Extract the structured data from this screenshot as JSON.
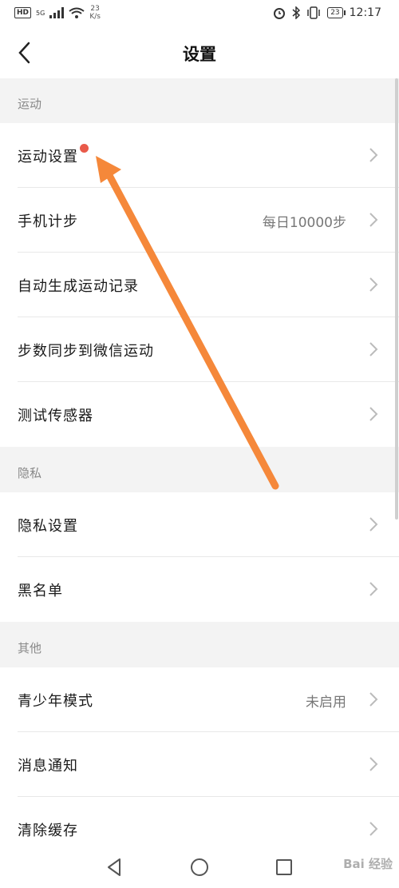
{
  "status_bar": {
    "network_badge": "HD",
    "signal_label": "5G",
    "net_speed_value": "23",
    "net_speed_unit": "K/s",
    "battery": "23",
    "time": "12:17"
  },
  "header": {
    "title": "设置"
  },
  "sections": [
    {
      "title": "运动",
      "items": [
        {
          "label": "运动设置",
          "value": "",
          "has_dot": true
        },
        {
          "label": "手机计步",
          "value": "每日10000步"
        },
        {
          "label": "自动生成运动记录",
          "value": ""
        },
        {
          "label": "步数同步到微信运动",
          "value": ""
        },
        {
          "label": "测试传感器",
          "value": ""
        }
      ]
    },
    {
      "title": "隐私",
      "items": [
        {
          "label": "隐私设置",
          "value": ""
        },
        {
          "label": "黑名单",
          "value": ""
        }
      ]
    },
    {
      "title": "其他",
      "items": [
        {
          "label": "青少年模式",
          "value": "未启用"
        },
        {
          "label": "消息通知",
          "value": ""
        },
        {
          "label": "清除缓存",
          "value": ""
        }
      ]
    }
  ],
  "watermark": "Bai 经验",
  "colors": {
    "annotation_arrow": "#f5883a",
    "red_dot": "#e95a4a"
  }
}
